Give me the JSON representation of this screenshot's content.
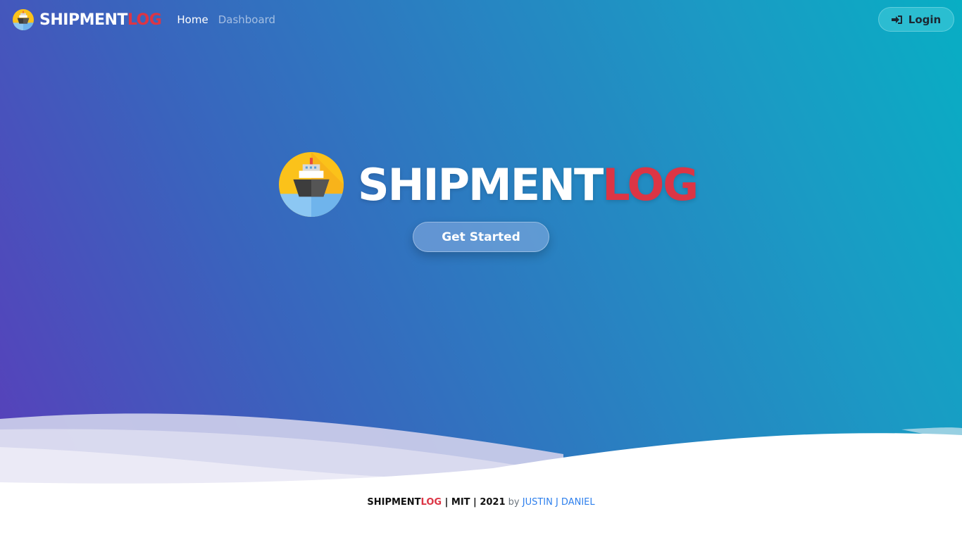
{
  "navbar": {
    "brand_main": "SHIPMENT",
    "brand_accent": "LOG",
    "links": [
      {
        "label": "Home",
        "active": true
      },
      {
        "label": "Dashboard",
        "active": false
      }
    ],
    "login_label": "Login",
    "login_icon": "sign-in-icon"
  },
  "hero": {
    "title_main": "SHIPMENT",
    "title_accent": "LOG",
    "logo_icon": "ship-icon",
    "cta_label": "Get Started"
  },
  "footer": {
    "brand_main": "SHIPMENT",
    "brand_accent": "LOG",
    "meta": " | MIT | 2021",
    "by": " by ",
    "author": "JUSTIN J DANIEL"
  },
  "colors": {
    "accent": "#dc3545",
    "link": "#2f80ed",
    "gradient_start": "#5a3dba",
    "gradient_end": "#08aec4"
  }
}
